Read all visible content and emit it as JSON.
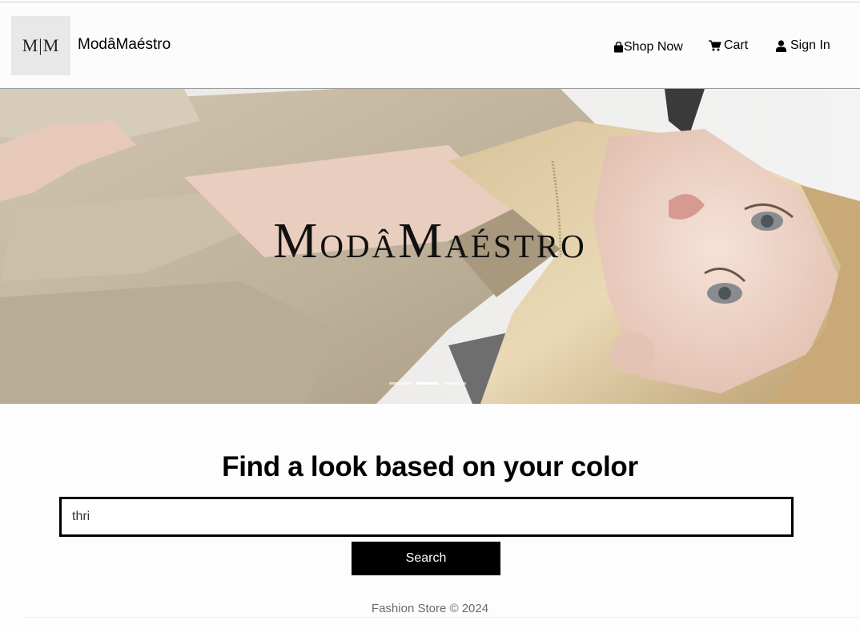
{
  "navbar": {
    "logo_text": "M|M",
    "brand": "ModâMaéstro",
    "items": [
      {
        "label": "Shop Now",
        "icon": "shopping-bag-icon"
      },
      {
        "label": "Cart",
        "icon": "cart-icon"
      },
      {
        "label": "Sign In",
        "icon": "user-icon"
      }
    ]
  },
  "hero": {
    "title_first": "M",
    "title_rest": "odâ",
    "title_second": "M",
    "title_rest2": "aéstro",
    "slides_count": 3,
    "active_slide": 2
  },
  "search": {
    "heading": "Find a look based on your color",
    "value": "thri",
    "button_label": "Search"
  },
  "footer": {
    "text": "Fashion Store © 2024"
  },
  "colors": {
    "accent": "#000000",
    "coat": "#c5b9a3",
    "hair": "#e2cfa6",
    "skin": "#efd6cb"
  }
}
